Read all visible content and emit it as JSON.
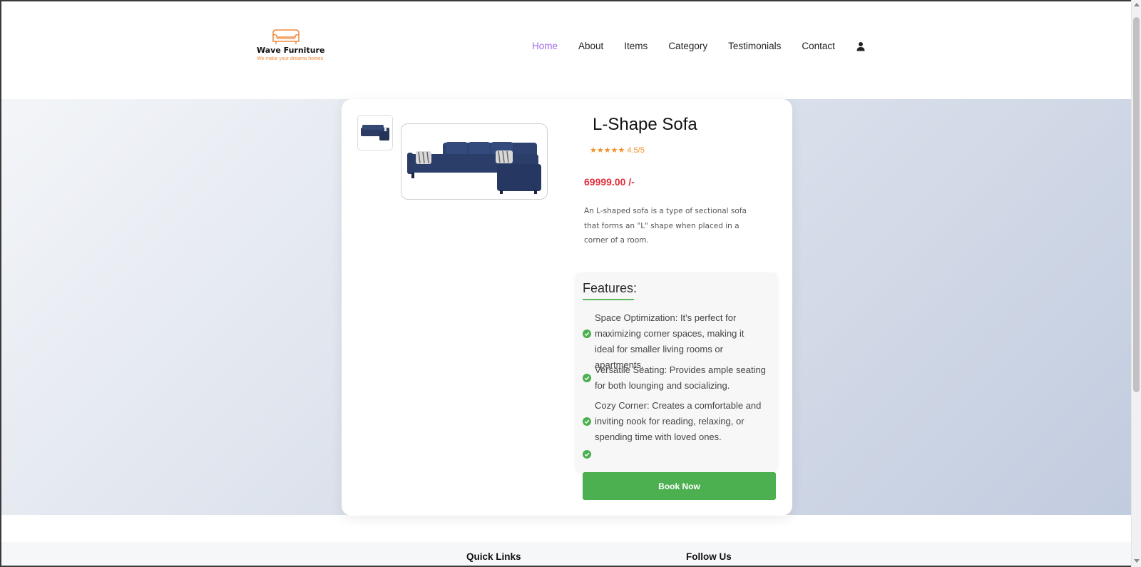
{
  "brand": {
    "name": "Wave Furniture",
    "tagline": "We make your dreams homes",
    "accent_color": "#f08a3c"
  },
  "nav": {
    "items": [
      {
        "label": "Home",
        "active": true
      },
      {
        "label": "About",
        "active": false
      },
      {
        "label": "Items",
        "active": false
      },
      {
        "label": "Category",
        "active": false
      },
      {
        "label": "Testimonials",
        "active": false
      },
      {
        "label": "Contact",
        "active": false
      }
    ],
    "user_icon": "user-icon",
    "active_color": "#a06be8"
  },
  "product": {
    "title": "L-Shape Sofa",
    "rating_text": "★★★★★ 4.5/5",
    "price": "69999.00 /-",
    "description": "An L-shaped sofa is a type of sectional sofa that forms an \"L\" shape when placed in a corner of a room.",
    "features_title": "Features:",
    "features": [
      "Space Optimization: It's perfect for maximizing corner spaces, making it ideal for smaller living rooms or apartments.",
      "Versatile Seating: Provides ample seating for both lounging and socializing.",
      "Cozy Corner: Creates a comfortable and inviting nook for reading, relaxing, or spending time with loved ones.",
      ""
    ],
    "book_label": "Book Now",
    "price_color": "#e0313f",
    "button_color": "#4caf50"
  },
  "footer": {
    "quick_links": "Quick Links",
    "follow_us": "Follow Us"
  }
}
